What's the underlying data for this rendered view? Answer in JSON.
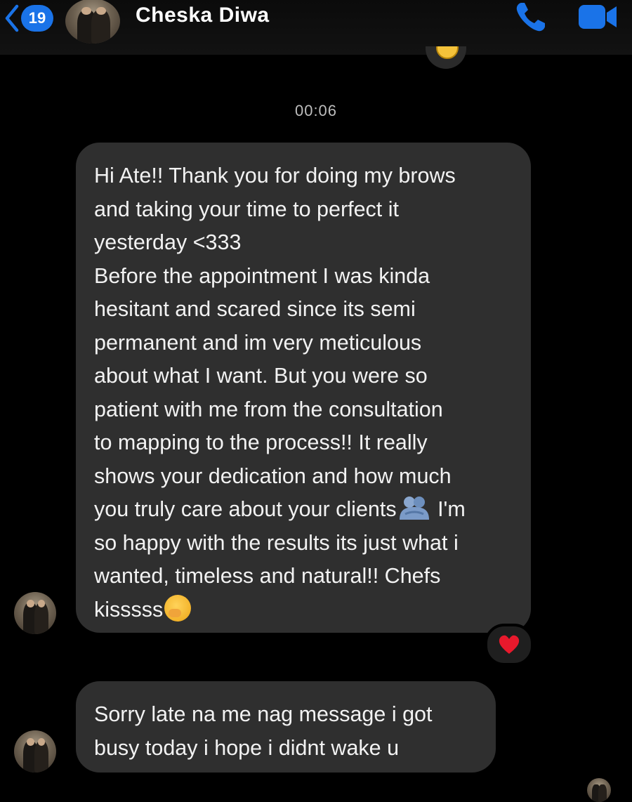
{
  "header": {
    "back_badge": "19",
    "contact_name": "Cheska Diwa"
  },
  "timestamp": "00:06",
  "messages": [
    {
      "text": "Hi Ate!! Thank you for doing my brows\nand taking your time to perfect it\nyesterday <333\nBefore the appointment I was kinda\nhesitant and scared since its semi\npermanent and im very meticulous\nabout what I want. But you were so\npatient with me from the consultation\nto mapping to the process!! It really\nshows your dedication and how much\nyou truly care about your clients",
      "text_after_emoji": " I'm\nso happy with the results its just what i\nwanted, timeless and natural!! Chefs\nkisssss",
      "reaction": "heart"
    },
    {
      "text": "Sorry late na me nag message i got\nbusy today i hope i didnt wake u"
    }
  ],
  "colors": {
    "accent": "#1a73e8",
    "bubble": "#2f2f2f",
    "background": "#000000"
  },
  "icons": [
    "back-chevron-icon",
    "phone-icon",
    "video-camera-icon",
    "heart-icon",
    "people-hugging-emoji-icon",
    "hugging-face-emoji-icon"
  ]
}
